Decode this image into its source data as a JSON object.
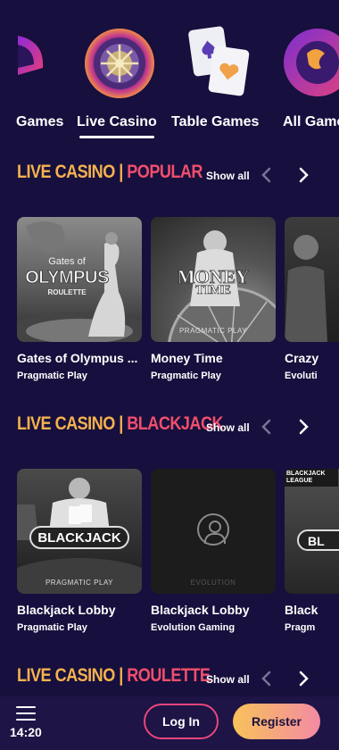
{
  "nav": {
    "categories": [
      {
        "label": "Games",
        "icon": "games-partial-icon"
      },
      {
        "label": "Live Casino",
        "icon": "roulette-wheel-icon",
        "active": true
      },
      {
        "label": "Table Games",
        "icon": "playing-cards-icon"
      },
      {
        "label": "All Games",
        "icon": "all-games-icon"
      }
    ]
  },
  "sections": [
    {
      "title_a": "LIVE CASINO | ",
      "title_b": "POPULAR",
      "show_all": "Show all",
      "cards": [
        {
          "title": "Gates of Olympus ...",
          "provider": "Pragmatic Play",
          "art_title": "Gates of",
          "art_title2": "OLYMPUS",
          "art_sub": "ROULETTE"
        },
        {
          "title": "Money Time",
          "provider": "Pragmatic Play",
          "art_title": "MONEY",
          "art_title2": "TIME",
          "art_tag": "PRAGMATIC PLAY"
        },
        {
          "title": "Crazy",
          "provider": "Evoluti"
        }
      ]
    },
    {
      "title_a": "LIVE CASINO | ",
      "title_b": "BLACKJACK",
      "show_all": "Show all",
      "cards": [
        {
          "title": "Blackjack Lobby",
          "provider": "Pragmatic Play",
          "art_title": "BLACKJACK",
          "art_tag": "PRAGMATIC PLAY"
        },
        {
          "title": "Blackjack Lobby",
          "provider": "Evolution Gaming",
          "art_tag": "EVOLUTION"
        },
        {
          "title": "Black",
          "provider": "Pragm",
          "art_title": "BLACKJACK",
          "art_title2": "LEAGUE",
          "art_sub": "BL"
        }
      ]
    },
    {
      "title_a": "LIVE CASINO | ",
      "title_b": "ROULETTE",
      "show_all": "Show all"
    }
  ],
  "bottom": {
    "time": "14:20",
    "login": "Log In",
    "register": "Register"
  },
  "colors": {
    "background": "#170f3d",
    "title_yellow": "#f4b24e",
    "title_pink": "#ef4f6c",
    "login_border": "#e8467c",
    "register_gradient": [
      "#f8c25a",
      "#f38aa3"
    ]
  }
}
